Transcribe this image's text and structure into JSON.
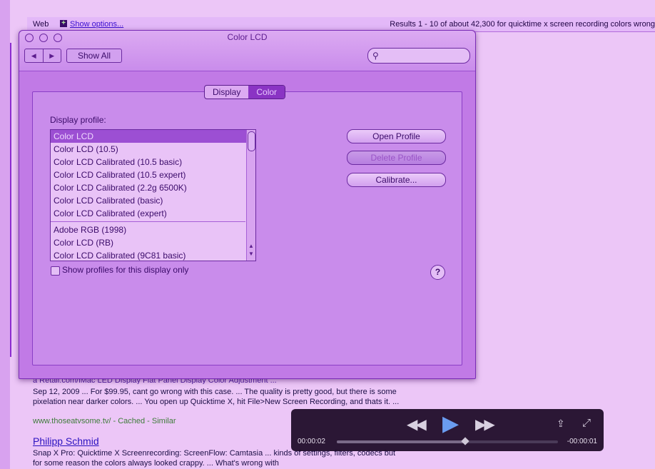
{
  "search_page": {
    "web_label": "Web",
    "plus_glyph": "+",
    "show_options": "Show options...",
    "results_summary": "Results 1 - 10 of about 42,300 for quicktime x screen recording colors wrong",
    "cut_line": "a Retail.com/iMac LED Display Flat Panel Display Color Adjustment ...",
    "result1_snippet": "Sep 12, 2009 ... For $99.95, cant go wrong with this case. ... The quality is pretty good, but there is some pixelation near darker colors. ... You open up Quicktime X, hit File>New Screen Recording, and thats it. ...",
    "result1_url": "www.thoseatvsome.tv/ - Cached - Similar",
    "result2_title": "Philipp Schmid",
    "result2_snippet": "Snap X Pro: Quicktime X Screenrecording: ScreenFlow: Camtasia ... kinds of settings, filters, codecs but for some reason the colors always looked crappy. ... What's wrong with"
  },
  "window": {
    "title": "Color LCD",
    "nav_back": "◀",
    "nav_forward": "▶",
    "show_all": "Show All",
    "search_icon": "magnifier-icon",
    "tabs": [
      "Display",
      "Color"
    ],
    "active_tab": "Color",
    "profile_label": "Display profile:",
    "profiles_group1": [
      "Color LCD",
      "Color LCD (10.5)",
      "Color LCD Calibrated (10.5 basic)",
      "Color LCD Calibrated (10.5 expert)",
      "Color LCD Calibrated (2.2g 6500K)",
      "Color LCD Calibrated (basic)",
      "Color LCD Calibrated (expert)"
    ],
    "profiles_group2": [
      "Adobe RGB (1998)",
      "Color LCD (RB)",
      "Color LCD Calibrated (9C81 basic)"
    ],
    "selected_profile": "Color LCD",
    "buttons": {
      "open_profile": "Open Profile",
      "delete_profile": "Delete Profile",
      "calibrate": "Calibrate..."
    },
    "checkbox_label": "Show profiles for this display only",
    "help": "?"
  },
  "player": {
    "elapsed": "00:00:02",
    "remaining": "-00:00:01",
    "progress": 0.58,
    "play_glyph": "▶",
    "rewind_glyph": "◀◀",
    "forward_glyph": "▶▶",
    "share_glyph": "⇪",
    "fullscreen_glyph": "⤢"
  },
  "colors": {
    "tint": "#c17ae6",
    "selection": "#9c4fd3",
    "play_blue": "#6a9cf0"
  }
}
